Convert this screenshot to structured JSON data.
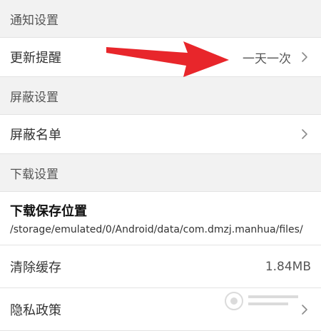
{
  "sections": {
    "notification": {
      "title": "通知设置"
    },
    "block": {
      "title": "屏蔽设置"
    },
    "download": {
      "title": "下载设置"
    }
  },
  "items": {
    "update_reminder": {
      "label": "更新提醒",
      "value": "一天一次"
    },
    "block_list": {
      "label": "屏蔽名单"
    },
    "storage": {
      "title": "下载保存位置",
      "path": "/storage/emulated/0/Android/data/com.dmzj.manhua/files/"
    },
    "clear_cache": {
      "label": "清除缓存",
      "value": "1.84MB"
    },
    "privacy_policy": {
      "label": "隐私政策"
    }
  },
  "colors": {
    "annotation_arrow": "#e8262b",
    "background": "#f2f2f2",
    "row_background": "#ffffff"
  }
}
